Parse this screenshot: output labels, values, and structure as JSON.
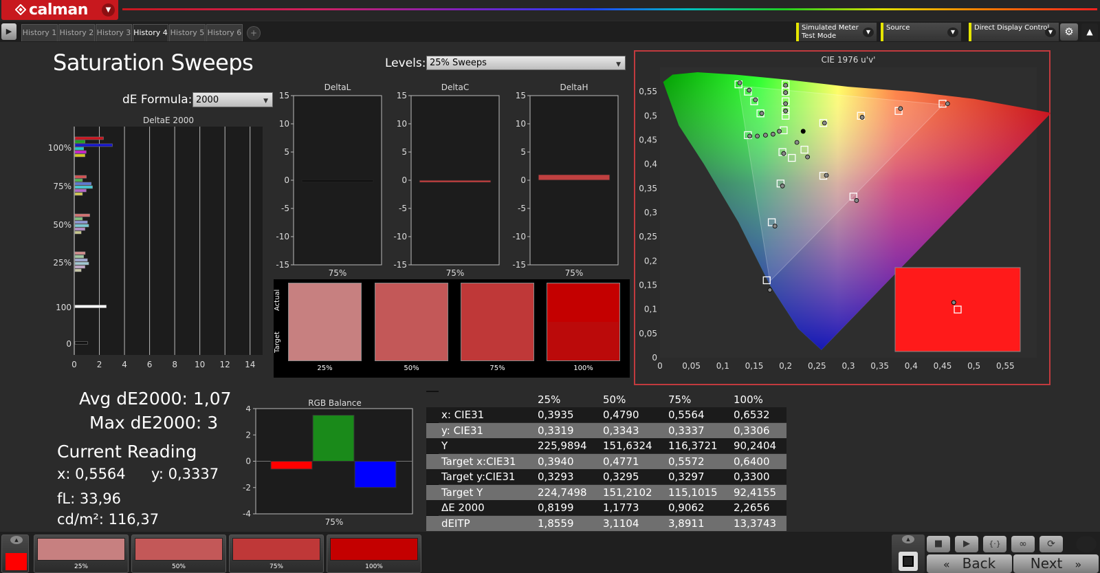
{
  "app": {
    "name": "calman",
    "drop_icon": "chevron-down-icon"
  },
  "tabs": [
    "History 1",
    "History 2",
    "History 3",
    "History 4",
    "History 5",
    "History 6",
    "+"
  ],
  "active_tab": 3,
  "meters": [
    {
      "label": "Simulated Meter",
      "sub": "Test Mode"
    },
    {
      "label": "Source",
      "sub": ""
    },
    {
      "label": "Direct Display Control",
      "sub": ""
    }
  ],
  "page_title": "Saturation Sweeps",
  "levels": {
    "label": "Levels:",
    "value": "25% Sweeps"
  },
  "de_formula": {
    "label": "dE Formula:",
    "value": "2000"
  },
  "deltaE_chart": {
    "title": "DeltaE 2000",
    "x_ticks": [
      "0",
      "2",
      "4",
      "6",
      "8",
      "10",
      "12",
      "14"
    ],
    "y_labels": [
      "100%",
      "75%",
      "50%",
      "25%",
      "100",
      "0"
    ],
    "xlim": [
      0,
      15
    ],
    "groups": [
      {
        "label": "100%",
        "bars": [
          {
            "v": 2.27,
            "c": "#c8141e"
          },
          {
            "v": 0.8,
            "c": "#1ea01e"
          },
          {
            "v": 2.98,
            "c": "#1414c8"
          },
          {
            "v": 0.7,
            "c": "#1ec8c8"
          },
          {
            "v": 0.9,
            "c": "#c81ec8"
          },
          {
            "v": 0.8,
            "c": "#d2c81e"
          }
        ]
      },
      {
        "label": "75%",
        "bars": [
          {
            "v": 0.91,
            "c": "#d25050"
          },
          {
            "v": 0.6,
            "c": "#50b450"
          },
          {
            "v": 1.3,
            "c": "#5a78d2"
          },
          {
            "v": 1.4,
            "c": "#46c8d2"
          },
          {
            "v": 0.9,
            "c": "#b464c8"
          },
          {
            "v": 0.6,
            "c": "#d2c850"
          }
        ]
      },
      {
        "label": "50%",
        "bars": [
          {
            "v": 1.18,
            "c": "#d27070"
          },
          {
            "v": 0.6,
            "c": "#80c080"
          },
          {
            "v": 1.0,
            "c": "#8c96d2"
          },
          {
            "v": 1.1,
            "c": "#78c8d2"
          },
          {
            "v": 0.8,
            "c": "#b48cc8"
          },
          {
            "v": 0.5,
            "c": "#c8c88c"
          }
        ]
      },
      {
        "label": "25%",
        "bars": [
          {
            "v": 0.82,
            "c": "#d28c8c"
          },
          {
            "v": 0.7,
            "c": "#a0c8a0"
          },
          {
            "v": 1.0,
            "c": "#a0a8d2"
          },
          {
            "v": 1.1,
            "c": "#a0c8d2"
          },
          {
            "v": 0.8,
            "c": "#c0a8c8"
          },
          {
            "v": 0.5,
            "c": "#c8c8a8"
          }
        ]
      },
      {
        "label": "100",
        "bars": [
          {
            "v": 2.5,
            "c": "#ffffff"
          }
        ]
      },
      {
        "label": "0",
        "bars": [
          {
            "v": 1.0,
            "c": "#111111"
          }
        ]
      }
    ]
  },
  "delta_charts": [
    {
      "title": "DeltaL",
      "value": 0.0,
      "x_label": "75%",
      "color": "#c04040"
    },
    {
      "title": "DeltaC",
      "value": -0.4,
      "x_label": "75%",
      "color": "#c04040"
    },
    {
      "title": "DeltaH",
      "value": 1.0,
      "x_label": "75%",
      "color": "#c04040"
    }
  ],
  "delta_ticks": [
    "15",
    "10",
    "5",
    "0",
    "-5",
    "-10",
    "-15"
  ],
  "swatches": {
    "actual_label": "Actual",
    "target_label": "Target",
    "items": [
      {
        "label": "25%",
        "actual": "#c78080",
        "target": "#c78080"
      },
      {
        "label": "50%",
        "actual": "#c35858",
        "target": "#c35858"
      },
      {
        "label": "75%",
        "actual": "#bf3838",
        "target": "#bf3838"
      },
      {
        "label": "100%",
        "actual": "#c40000",
        "target": "#bb0a0a"
      }
    ]
  },
  "cie": {
    "title": "CIE 1976 u'v'",
    "x_ticks": [
      "0",
      "0,05",
      "0,1",
      "0,15",
      "0,2",
      "0,25",
      "0,3",
      "0,35",
      "0,4",
      "0,45",
      "0,5",
      "0,55"
    ],
    "y_ticks": [
      "0",
      "0,05",
      "0,1",
      "0,15",
      "0,2",
      "0,25",
      "0,3",
      "0,35",
      "0,4",
      "0,45",
      "0,5",
      "0,55"
    ],
    "xlim": [
      0,
      0.6
    ],
    "ylim": [
      0,
      0.6
    ],
    "targets": [
      [
        0.125,
        0.565
      ],
      [
        0.14,
        0.55
      ],
      [
        0.15,
        0.53
      ],
      [
        0.16,
        0.505
      ],
      [
        0.14,
        0.46
      ],
      [
        0.197,
        0.47
      ],
      [
        0.2,
        0.565
      ],
      [
        0.2,
        0.55
      ],
      [
        0.2,
        0.53
      ],
      [
        0.2,
        0.51
      ],
      [
        0.2,
        0.5
      ],
      [
        0.195,
        0.425
      ],
      [
        0.23,
        0.43
      ],
      [
        0.26,
        0.485
      ],
      [
        0.32,
        0.5
      ],
      [
        0.38,
        0.51
      ],
      [
        0.45,
        0.525
      ],
      [
        0.192,
        0.36
      ],
      [
        0.178,
        0.28
      ],
      [
        0.17,
        0.16
      ],
      [
        0.21,
        0.413
      ],
      [
        0.26,
        0.376
      ],
      [
        0.308,
        0.333
      ]
    ],
    "measured": [
      [
        0.127,
        0.568
      ],
      [
        0.142,
        0.553
      ],
      [
        0.152,
        0.533
      ],
      [
        0.162,
        0.505
      ],
      [
        0.143,
        0.458
      ],
      [
        0.155,
        0.458
      ],
      [
        0.168,
        0.46
      ],
      [
        0.18,
        0.462
      ],
      [
        0.19,
        0.468
      ],
      [
        0.2,
        0.563
      ],
      [
        0.2,
        0.548
      ],
      [
        0.2,
        0.525
      ],
      [
        0.2,
        0.51
      ],
      [
        0.218,
        0.445
      ],
      [
        0.197,
        0.422
      ],
      [
        0.235,
        0.415
      ],
      [
        0.262,
        0.485
      ],
      [
        0.322,
        0.497
      ],
      [
        0.383,
        0.515
      ],
      [
        0.458,
        0.525
      ],
      [
        0.195,
        0.355
      ],
      [
        0.183,
        0.272
      ],
      [
        0.175,
        0.14
      ],
      [
        0.265,
        0.377
      ],
      [
        0.313,
        0.325
      ]
    ],
    "white": [
      0.228,
      0.468
    ],
    "inset": {
      "color": "#ff1a1a",
      "target": [
        0.5,
        0.5
      ],
      "measured": [
        0.485,
        0.58
      ]
    }
  },
  "stats": {
    "avg": "Avg dE2000: 1,07",
    "max": "Max dE2000: 3",
    "current_reading": "Current Reading",
    "x": "x: 0,5564",
    "y": "y: 0,3337",
    "fl": "fL: 33,96",
    "cdm2": "cd/m²: 116,37"
  },
  "rgb_balance": {
    "title": "RGB Balance",
    "x_label": "75%",
    "y_ticks": [
      "4",
      "2",
      "0",
      "-2",
      "-4"
    ],
    "ylim": [
      -4,
      4
    ],
    "bars": [
      {
        "v": -0.6,
        "c": "#ff0000"
      },
      {
        "v": 3.5,
        "c": "#1a8a1a"
      },
      {
        "v": -2.0,
        "c": "#0000ff"
      }
    ]
  },
  "table": {
    "headers": [
      "",
      "25%",
      "50%",
      "75%",
      "100%"
    ],
    "rows": [
      [
        "x: CIE31",
        "0,3935",
        "0,4790",
        "0,5564",
        "0,6532"
      ],
      [
        "y: CIE31",
        "0,3319",
        "0,3343",
        "0,3337",
        "0,3306"
      ],
      [
        "Y",
        "225,9894",
        "151,6324",
        "116,3721",
        "90,2404"
      ],
      [
        "Target x:CIE31",
        "0,3940",
        "0,4771",
        "0,5572",
        "0,6400"
      ],
      [
        "Target y:CIE31",
        "0,3293",
        "0,3295",
        "0,3297",
        "0,3300"
      ],
      [
        "Target Y",
        "224,7498",
        "151,2102",
        "115,1015",
        "92,4155"
      ],
      [
        "ΔE 2000",
        "0,8199",
        "1,1773",
        "0,9062",
        "2,2656"
      ],
      [
        "dEITP",
        "1,8559",
        "3,1104",
        "3,8911",
        "13,3743"
      ]
    ]
  },
  "bottom": {
    "current_color": "#ff0000",
    "patches": [
      {
        "label": "25%",
        "color": "#c78080"
      },
      {
        "label": "50%",
        "color": "#c35858"
      },
      {
        "label": "75%",
        "color": "#bf3838"
      },
      {
        "label": "100%",
        "color": "#c40000"
      }
    ],
    "back_label": "Back",
    "next_label": "Next"
  }
}
